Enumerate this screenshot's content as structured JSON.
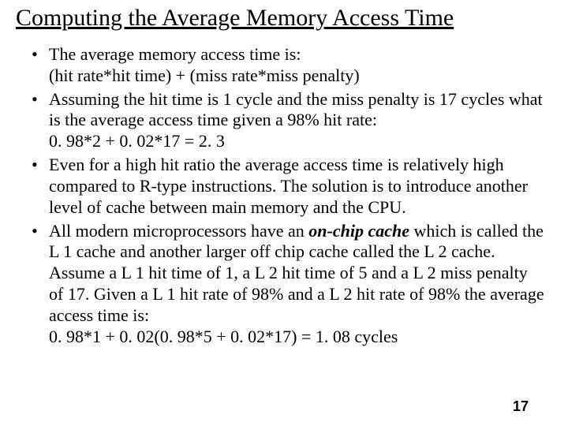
{
  "title": "Computing the Average Memory Access Time",
  "bullets": [
    {
      "line1": "The average memory access time is:",
      "line2": "(hit rate*hit time) + (miss rate*miss penalty)"
    },
    {
      "line1": "Assuming the hit time is 1 cycle and the miss penalty is 17 cycles what is the average access time given a 98% hit rate:",
      "line2": "0. 98*2 + 0. 02*17 = 2. 3"
    },
    {
      "line1": "Even for a high hit ratio the average access time is relatively high compared to R-type instructions. The solution is to introduce another level of cache between main memory and the CPU."
    },
    {
      "prefix": "All modern microprocessors have an ",
      "em": "on-chip cache",
      "suffix": " which is called the L 1 cache and another larger off chip cache called the L 2 cache. Assume a L 1 hit time of 1, a L 2 hit time of 5 and a L 2 miss penalty of 17. Given a L 1 hit rate of 98% and a L 2 hit rate of 98% the average access time is:",
      "line2": "0. 98*1 + 0. 02(0. 98*5 + 0. 02*17) = 1. 08 cycles"
    }
  ],
  "pageNumber": "17"
}
